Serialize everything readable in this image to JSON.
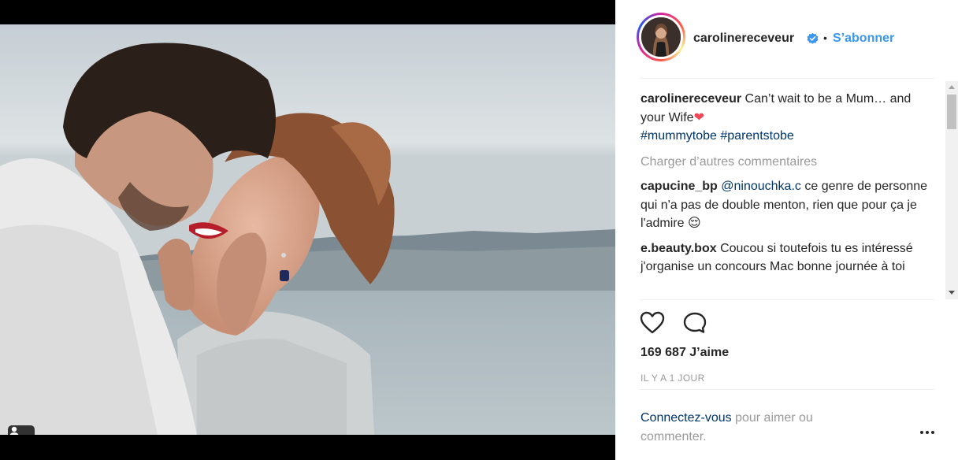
{
  "post": {
    "username": "carolinereceveur",
    "separator": "•",
    "follow_label": "S’abonner",
    "caption_text": "Can’t wait to be a Mum… and your Wife",
    "caption_heart": "❤",
    "hashtag_1": "#mummytobe",
    "hashtag_2": "#parentstobe",
    "load_more": "Charger d’autres commentaires",
    "comments": [
      {
        "user": "capucine_bp",
        "mention": "@ninouchka.c",
        "text": " ce genre de personne qui n'a pas de double menton, rien que pour ça je l'admire ",
        "emoji": "😌"
      },
      {
        "user": "e.beauty.box",
        "mention": "",
        "text": "Coucou si toutefois tu es intéressé j'organise un concours Mac bonne journée à toi",
        "emoji": ""
      }
    ],
    "likes": "169 687 J’aime",
    "time": "IL Y A 1 JOUR",
    "login_link": "Connectez-vous",
    "login_rest": " pour aimer ou commenter."
  },
  "icons": {
    "like": "heart-outline-icon",
    "comment": "speech-bubble-icon",
    "verified": "verified-badge-icon",
    "tag_user": "person-icon",
    "more": "ellipsis-icon"
  },
  "colors": {
    "link_blue": "#3897f0",
    "dark_link": "#003569",
    "muted": "#999999",
    "heart": "#ed4956"
  },
  "carousel": {
    "total": 2,
    "active": 2
  }
}
